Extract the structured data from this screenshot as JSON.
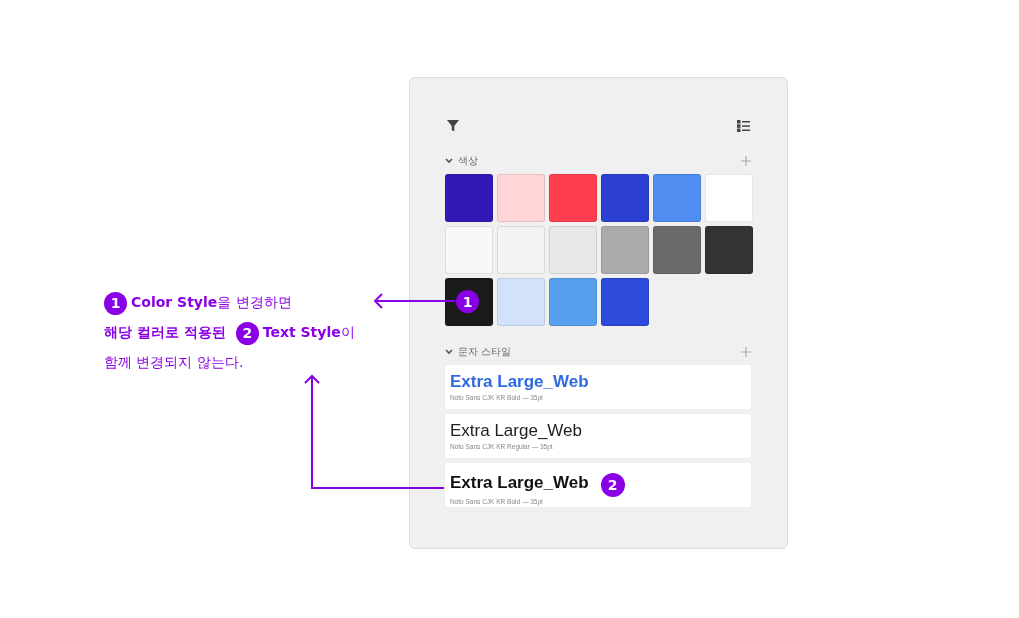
{
  "annotation": {
    "lines": [
      {
        "badge": "1",
        "text": "**Color Style**을 변경하면"
      },
      {
        "lead": "해당 컬러로 적용된",
        "badge": "2",
        "text": "**Text Style**이"
      },
      {
        "text": "함께 변경되지 않는다."
      }
    ]
  },
  "panel": {
    "colors": {
      "title": "색상",
      "expanded": true,
      "swatches": [
        {
          "color": "#3219b5"
        },
        {
          "color": "#ffd5d7"
        },
        {
          "color": "#ff3f4f"
        },
        {
          "color": "#2c3fd3"
        },
        {
          "color": "#4f8ef0"
        },
        {
          "color": "#ffffff"
        },
        {
          "color": "#f8f8f8"
        },
        {
          "color": "#f3f3f3"
        },
        {
          "color": "#e8e8e8"
        },
        {
          "color": "#ababab"
        },
        {
          "color": "#6a6a6a"
        },
        {
          "color": "#333333"
        },
        {
          "color": "#1a1a1a",
          "badge": "1"
        },
        {
          "color": "#d3e2fb"
        },
        {
          "color": "#58a0ee"
        },
        {
          "color": "#2c4bdb"
        }
      ]
    },
    "text_styles": {
      "title": "문자 스타일",
      "expanded": true,
      "items": [
        {
          "name": "Extra Large_Web",
          "meta": "Noto Sans CJK KR Bold — 35pt",
          "kind": "bold",
          "color": "#2f6ae0"
        },
        {
          "name": "Extra Large_Web",
          "meta": "Noto Sans CJK KR Regular — 35pt",
          "kind": "regular",
          "color": "#222222"
        },
        {
          "name": "Extra Large_Web",
          "meta": "Noto Sans CJK KR Bold — 35pt",
          "kind": "bold",
          "color": "#111111",
          "badge": "2"
        }
      ]
    }
  }
}
